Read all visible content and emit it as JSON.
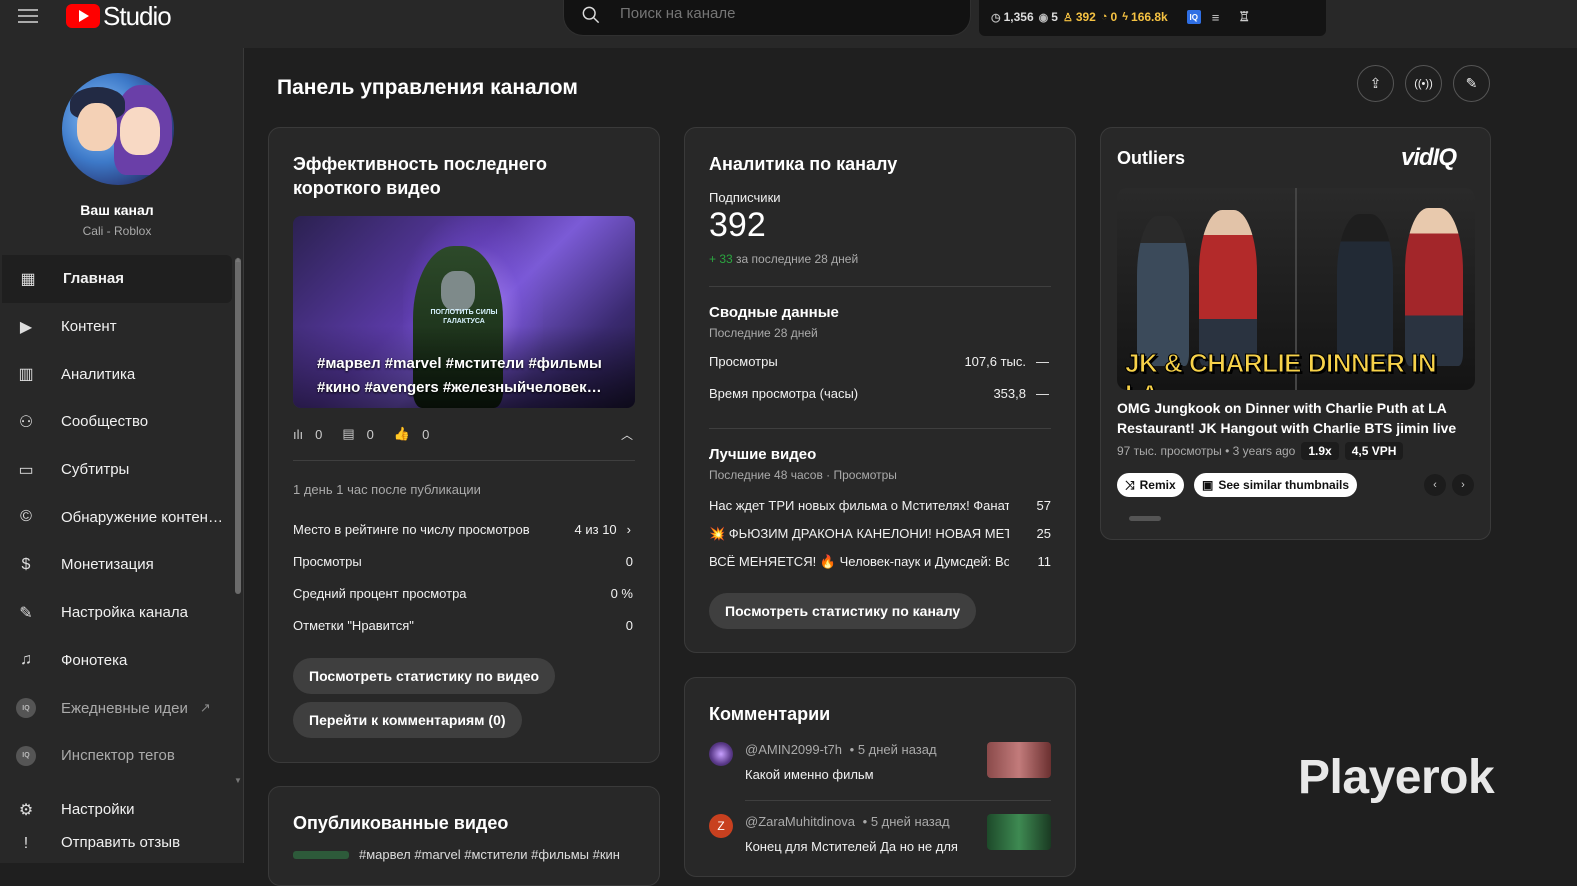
{
  "app": {
    "logo_text": "Studio"
  },
  "search": {
    "placeholder": "Поиск на канале"
  },
  "stats": {
    "views": "1,356",
    "watching": "5",
    "subs": "392",
    "hours": "0",
    "score": "166.8k"
  },
  "channel": {
    "name": "Ваш канал",
    "subtitle": "Cali - Roblox"
  },
  "nav": {
    "items": [
      {
        "label": "Главная"
      },
      {
        "label": "Контент"
      },
      {
        "label": "Аналитика"
      },
      {
        "label": "Сообщество"
      },
      {
        "label": "Субтитры"
      },
      {
        "label": "Обнаружение контен…"
      },
      {
        "label": "Монетизация"
      },
      {
        "label": "Настройка канала"
      },
      {
        "label": "Фонотека"
      },
      {
        "label": "Ежедневные идеи"
      },
      {
        "label": "Инспектор тегов"
      }
    ],
    "settings": "Настройки",
    "feedback": "Отправить отзыв"
  },
  "page": {
    "title": "Панель управления каналом"
  },
  "latest_short": {
    "title": "Эффективность последнего короткого видео",
    "thumb_tags": "#марвел #marvel #мстители #фильмы #кино #avengers #железныйчеловек…",
    "thumb_overlay": "ПОГЛОТИТЬ СИЛЫ ГАЛАКТУСА",
    "views_count": "0",
    "comments_count": "0",
    "likes_count": "0",
    "since": "1 день 1 час после публикации",
    "rows": [
      {
        "label": "Место в рейтинге по числу просмотров",
        "value": "4 из 10"
      },
      {
        "label": "Просмотры",
        "value": "0"
      },
      {
        "label": "Средний процент просмотра",
        "value": "0 %"
      },
      {
        "label": "Отметки \"Нравится\"",
        "value": "0"
      }
    ],
    "btn_stats": "Посмотреть статистику по видео",
    "btn_comments": "Перейти к комментариям (0)"
  },
  "published": {
    "title": "Опубликованные видео",
    "first_item": "#марвел #marvel #мстители #фильмы #кин"
  },
  "analytics": {
    "title": "Аналитика по каналу",
    "subs_label": "Подписчики",
    "subs_value": "392",
    "subs_delta": "+ 33",
    "subs_period": "за последние 28 дней",
    "summary_title": "Сводные данные",
    "summary_period": "Последние 28 дней",
    "summary_rows": [
      {
        "label": "Просмотры",
        "value": "107,6 тыс.",
        "trend": "—"
      },
      {
        "label": "Время просмотра (часы)",
        "value": "353,8",
        "trend": "—"
      }
    ],
    "top_title": "Лучшие видео",
    "top_period": "Последние 48 часов · Просмотры",
    "top_videos": [
      {
        "title": "Нас ждет ТРИ новых фильма о Мстителях! Фанат…",
        "views": "57"
      },
      {
        "title": "💥 ФЬЮЗИМ ДРАКОНА КАНЕЛОНИ! НОВАЯ МЕТА …",
        "views": "25"
      },
      {
        "title": "ВСЁ МЕНЯЕТСЯ! 🔥 Человек-паук и Думсдей: Возв…",
        "views": "11"
      }
    ],
    "btn": "Посмотреть статистику по каналу"
  },
  "comments": {
    "title": "Комментарии",
    "items": [
      {
        "user": "@AMIN2099-t7h",
        "time": "• 5 дней назад",
        "text": "Какой именно фильм",
        "avatar_letter": ""
      },
      {
        "user": "@ZaraMuhitdinova",
        "time": "• 5 дней назад",
        "text": "Конец для Мстителей Да но не для",
        "avatar_letter": "Z"
      }
    ]
  },
  "outliers": {
    "title": "Outliers",
    "brand": "vidIQ",
    "thumb_caption": "JK & CHARLIE DINNER IN LA",
    "video_title": "OMG Jungkook on Dinner with Charlie Puth at LA Restaurant! JK Hangout with Charlie BTS jimin live",
    "meta": "97 тыс. просмотры • 3 years ago",
    "multiplier": "1.9x",
    "vph": "4,5 VPH",
    "remix": "Remix",
    "similar": "See similar thumbnails"
  },
  "watermark": "Playerok",
  "colors": {
    "accent_gold": "#f5c242",
    "positive": "#2ba640",
    "brand_red": "#ff0000",
    "vidiq_blue": "#2f6fe4"
  }
}
